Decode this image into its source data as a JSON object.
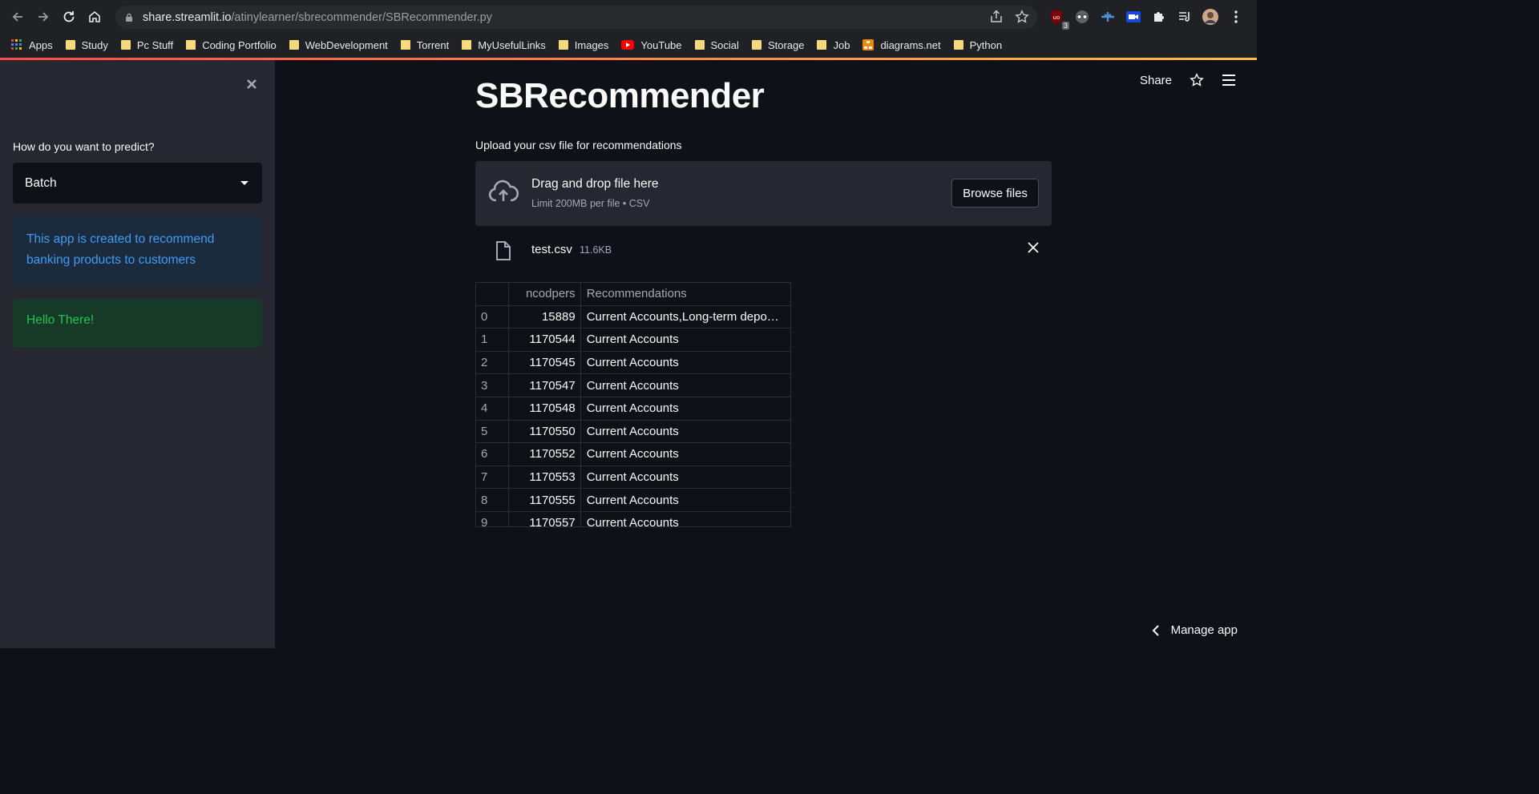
{
  "browser": {
    "url_host": "share.streamlit.io",
    "url_path": "/atinylearner/sbrecommender/SBRecommender.py",
    "extension_badge": "3",
    "bookmarks": [
      {
        "label": "Apps",
        "icon": "apps-grid-icon"
      },
      {
        "label": "Study",
        "icon": "folder-icon"
      },
      {
        "label": "Pc Stuff",
        "icon": "folder-icon"
      },
      {
        "label": "Coding Portfolio",
        "icon": "folder-icon"
      },
      {
        "label": "WebDevelopment",
        "icon": "folder-icon"
      },
      {
        "label": "Torrent",
        "icon": "folder-icon"
      },
      {
        "label": "MyUsefulLinks",
        "icon": "folder-icon"
      },
      {
        "label": "Images",
        "icon": "folder-icon"
      },
      {
        "label": "YouTube",
        "icon": "youtube-icon"
      },
      {
        "label": "Social",
        "icon": "folder-icon"
      },
      {
        "label": "Storage",
        "icon": "folder-icon"
      },
      {
        "label": "Job",
        "icon": "folder-icon"
      },
      {
        "label": "diagrams.net",
        "icon": "diagrams-icon"
      },
      {
        "label": "Python",
        "icon": "folder-icon"
      }
    ]
  },
  "sidebar": {
    "predict_label": "How do you want to predict?",
    "predict_value": "Batch",
    "info_text": "This app is created to recommend banking products to customers",
    "success_text": "Hello There!"
  },
  "header": {
    "share_label": "Share"
  },
  "main": {
    "title": "SBRecommender",
    "upload_label": "Upload your csv file for recommendations",
    "dropzone_title": "Drag and drop file here",
    "dropzone_sub": "Limit 200MB per file • CSV",
    "browse_label": "Browse files",
    "file_name": "test.csv",
    "file_size": "11.6KB"
  },
  "table": {
    "columns": [
      "",
      "ncodpers",
      "Recommendations"
    ],
    "rows": [
      [
        "0",
        "15889",
        "Current Accounts,Long-term depo…"
      ],
      [
        "1",
        "1170544",
        "Current Accounts"
      ],
      [
        "2",
        "1170545",
        "Current Accounts"
      ],
      [
        "3",
        "1170547",
        "Current Accounts"
      ],
      [
        "4",
        "1170548",
        "Current Accounts"
      ],
      [
        "5",
        "1170550",
        "Current Accounts"
      ],
      [
        "6",
        "1170552",
        "Current Accounts"
      ],
      [
        "7",
        "1170553",
        "Current Accounts"
      ],
      [
        "8",
        "1170555",
        "Current Accounts"
      ],
      [
        "9",
        "1170557",
        "Current Accounts"
      ]
    ]
  },
  "footer": {
    "manage_label": "Manage app"
  },
  "colors": {
    "accent_red": "#ff4b4b",
    "info_blue": "#3d9df3",
    "success_green": "#21c354"
  }
}
